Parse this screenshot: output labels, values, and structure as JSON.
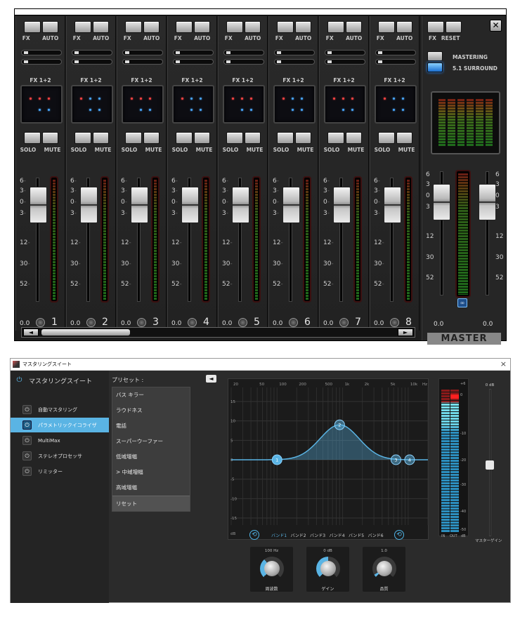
{
  "mixer": {
    "channel_labels": {
      "fx": "FX",
      "auto": "AUTO",
      "send": "FX 1+2",
      "solo": "SOLO",
      "mute": "MUTE"
    },
    "scale": [
      "6",
      "3",
      "0",
      "3",
      "12",
      "30",
      "52"
    ],
    "channels": [
      {
        "number": "1",
        "pan": "0.0"
      },
      {
        "number": "2",
        "pan": "0.0"
      },
      {
        "number": "3",
        "pan": "0.0"
      },
      {
        "number": "4",
        "pan": "0.0"
      },
      {
        "number": "5",
        "pan": "0.0"
      },
      {
        "number": "6",
        "pan": "0.0"
      },
      {
        "number": "7",
        "pan": "0.0"
      },
      {
        "number": "8",
        "pan": "0.0"
      }
    ],
    "master": {
      "fx": "FX",
      "reset": "RESET",
      "close": "✕",
      "mastering": "MASTERING",
      "surround": "5.1 SURROUND",
      "pan_left": "0.0",
      "pan_right": "0.0",
      "label": "MASTER",
      "link_icon": "∞"
    },
    "scroll_left": "◄",
    "scroll_right": "►"
  },
  "mastering": {
    "title": "マスタリングスイート",
    "close": "×",
    "sidebar_header": "マスタリングスイート",
    "modules": [
      {
        "label": "自動マスタリング",
        "selected": false
      },
      {
        "label": "パラメトリックイコライザ",
        "selected": true
      },
      {
        "label": "MultiMax",
        "selected": false
      },
      {
        "label": "ステレオプロセッサ",
        "selected": false
      },
      {
        "label": "リミッター",
        "selected": false
      }
    ],
    "preset_label": "プリセット :",
    "presets": [
      "バス キラー",
      "ラウドネス",
      "電話",
      "スーパーウーファー",
      "低域増幅",
      "> 中域増幅",
      "高域増幅",
      "リセット"
    ],
    "back_icon": "◄",
    "eq": {
      "freq_labels": [
        "20",
        "50",
        "100",
        "200",
        "500",
        "1k",
        "2k",
        "5k",
        "10k",
        "Hz"
      ],
      "db_labels": [
        "15",
        "10",
        "5",
        "0",
        "-5",
        "-10",
        "-15",
        "dB"
      ],
      "bands": [
        "バンド1",
        "バンド2",
        "バンド3",
        "バンド4",
        "バンド5",
        "バンド6"
      ],
      "active_band": 0,
      "points": [
        "1",
        "2",
        "3",
        "4"
      ]
    },
    "knobs": [
      {
        "value": "100 Hz",
        "label": "周波数",
        "level": 0.35
      },
      {
        "value": "0 dB",
        "label": "ゲイン",
        "level": 0.5
      },
      {
        "value": "1.0",
        "label": "品質",
        "level": 0.05
      }
    ],
    "meter": {
      "ticks": [
        "+6",
        "0",
        "-10",
        "-20",
        "-30",
        "-40",
        "-50"
      ],
      "in_label": "IN",
      "out_label": "OUT",
      "unit": "dB"
    },
    "master_gain": {
      "value": "0 dB",
      "label": "マスターゲイン"
    },
    "colors": {
      "accent": "#5ab4e4",
      "background": "#2b2b2b"
    }
  }
}
